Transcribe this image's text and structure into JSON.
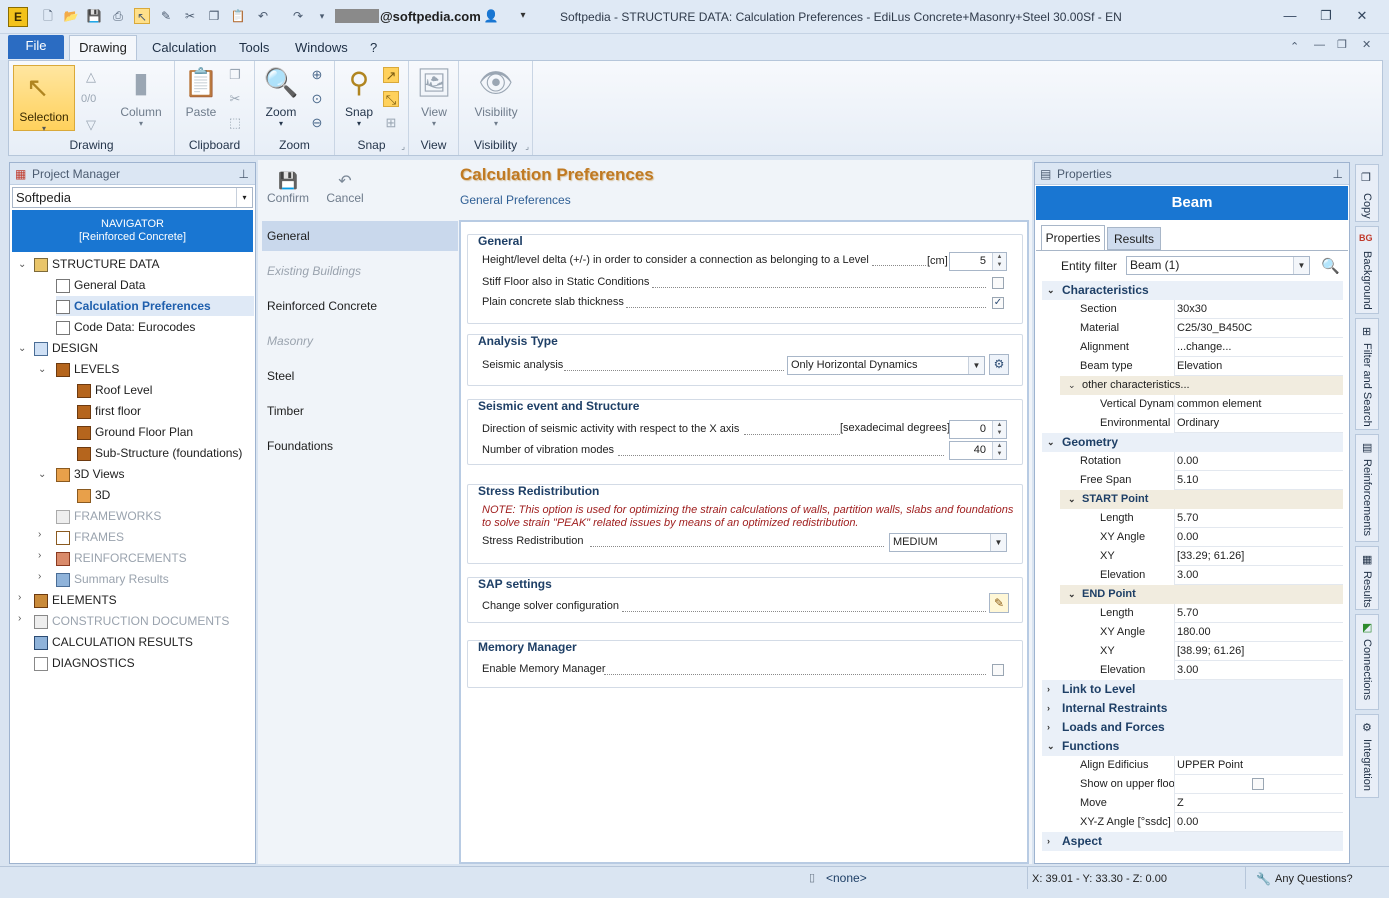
{
  "titlebar": {
    "user": "@softpedia.com",
    "title": "Softpedia  -  STRUCTURE DATA: Calculation Preferences - EdiLus Concrete+Masonry+Steel 30.00Sf - EN",
    "app_letter": "E"
  },
  "ribbon": {
    "file": "File",
    "tabs": [
      "Drawing",
      "Calculation",
      "Tools",
      "Windows",
      "?"
    ],
    "groups": {
      "drawing": "Drawing",
      "clipboard": "Clipboard",
      "zoom": "Zoom",
      "snap": "Snap",
      "view": "View",
      "visibility": "Visibility"
    },
    "buttons": {
      "selection": "Selection",
      "counter": "0/0",
      "column": "Column",
      "paste": "Paste",
      "zoom": "Zoom",
      "snap": "Snap",
      "view": "View",
      "visibility": "Visibility"
    }
  },
  "project_manager": {
    "title": "Project Manager",
    "project": "Softpedia",
    "navigator": "NAVIGATOR",
    "navigator_sub": "[Reinforced Concrete]",
    "tree": {
      "structure_data": "STRUCTURE DATA",
      "general_data": "General Data",
      "calc_prefs": "Calculation Preferences",
      "code_data": "Code Data: Eurocodes",
      "design": "DESIGN",
      "levels": "LEVELS",
      "roof": "Roof Level",
      "first": "first floor",
      "ground": "Ground Floor Plan",
      "sub": "Sub-Structure (foundations)",
      "views3d": "3D Views",
      "v3d": "3D",
      "frameworks": "FRAMEWORKS",
      "frames": "FRAMES",
      "reinforcements": "REINFORCEMENTS",
      "summary": "Summary Results",
      "elements": "ELEMENTS",
      "construction": "CONSTRUCTION DOCUMENTS",
      "calc_results": "CALCULATION RESULTS",
      "diagnostics": "DIAGNOSTICS"
    }
  },
  "toolbar": {
    "confirm": "Confirm",
    "cancel": "Cancel"
  },
  "page": {
    "title": "Calculation Preferences",
    "subtitle": "General Preferences"
  },
  "nav": [
    "General",
    "Existing Buildings",
    "Reinforced Concrete",
    "Masonry",
    "Steel",
    "Timber",
    "Foundations"
  ],
  "sections": {
    "general": {
      "title": "General",
      "height_label": "Height/level delta (+/-) in order to consider a connection as belonging to a Level",
      "height_unit": "[cm]",
      "height_value": "5",
      "stiff_floor": "Stiff Floor also in Static Conditions",
      "plain_slab": "Plain concrete slab thickness"
    },
    "analysis": {
      "title": "Analysis Type",
      "seismic_label": "Seismic analysis",
      "seismic_value": "Only Horizontal Dynamics"
    },
    "seismic": {
      "title": "Seismic event and Structure",
      "direction_label": "Direction of seismic activity with respect to the X axis",
      "direction_unit": "[sexadecimal degrees]",
      "direction_value": "0",
      "modes_label": "Number of vibration modes",
      "modes_value": "40"
    },
    "stress": {
      "title": "Stress Redistribution",
      "note1": "NOTE: This option is used for optimizing the strain calculations of walls, partition walls, slabs and foundations",
      "note2": "to solve strain \"PEAK\" related issues by means of an optimized redistribution.",
      "label": "Stress Redistribution",
      "value": "MEDIUM"
    },
    "sap": {
      "title": "SAP settings",
      "label": "Change solver configuration"
    },
    "memory": {
      "title": "Memory Manager",
      "label": "Enable Memory Manager"
    }
  },
  "properties": {
    "title": "Properties",
    "header": "Beam",
    "tab_props": "Properties",
    "tab_results": "Results",
    "entity_filter_label": "Entity filter",
    "entity_filter_value": "Beam (1)",
    "cat_characteristics": "Characteristics",
    "section_k": "Section",
    "section_v": "30x30",
    "material_k": "Material",
    "material_v": "C25/30_B450C",
    "alignment_k": "Alignment",
    "alignment_v": "...change...",
    "beamtype_k": "Beam type",
    "beamtype_v": "Elevation",
    "other_char": "other characteristics...",
    "vertdyn_k": "Vertical Dynam",
    "vertdyn_v": "common element",
    "env_k": "Environmental",
    "env_v": "Ordinary",
    "cat_geometry": "Geometry",
    "rotation_k": "Rotation",
    "rotation_v": "0.00",
    "freespan_k": "Free Span",
    "freespan_v": "5.10",
    "start_point": "START Point",
    "s_length_k": "Length",
    "s_length_v": "5.70",
    "s_xyangle_k": "XY Angle",
    "s_xyangle_v": "0.00",
    "s_xy_k": "XY",
    "s_xy_v": "[33.29; 61.26]",
    "s_elev_k": "Elevation",
    "s_elev_v": "3.00",
    "end_point": "END Point",
    "e_length_k": "Length",
    "e_length_v": "5.70",
    "e_xyangle_k": "XY Angle",
    "e_xyangle_v": "180.00",
    "e_xy_k": "XY",
    "e_xy_v": "[38.99; 61.26]",
    "e_elev_k": "Elevation",
    "e_elev_v": "3.00",
    "cat_link": "Link to Level",
    "cat_restraints": "Internal Restraints",
    "cat_loads": "Loads and Forces",
    "cat_functions": "Functions",
    "align_k": "Align Edificius",
    "align_v": "UPPER Point",
    "showupper_k": "Show on upper floo",
    "move_k": "Move",
    "move_v": "Z",
    "xyz_k": "XY-Z Angle  [°ssdc]",
    "xyz_v": "0.00",
    "cat_aspect": "Aspect"
  },
  "side_tabs": [
    "Copy",
    "Background",
    "Filter and Search",
    "Reinforcements",
    "Results",
    "Connections",
    "Integration"
  ],
  "status": {
    "none": "<none>",
    "coords": "X: 39.01 - Y: 33.30 - Z: 0.00",
    "questions": "Any Questions?"
  }
}
